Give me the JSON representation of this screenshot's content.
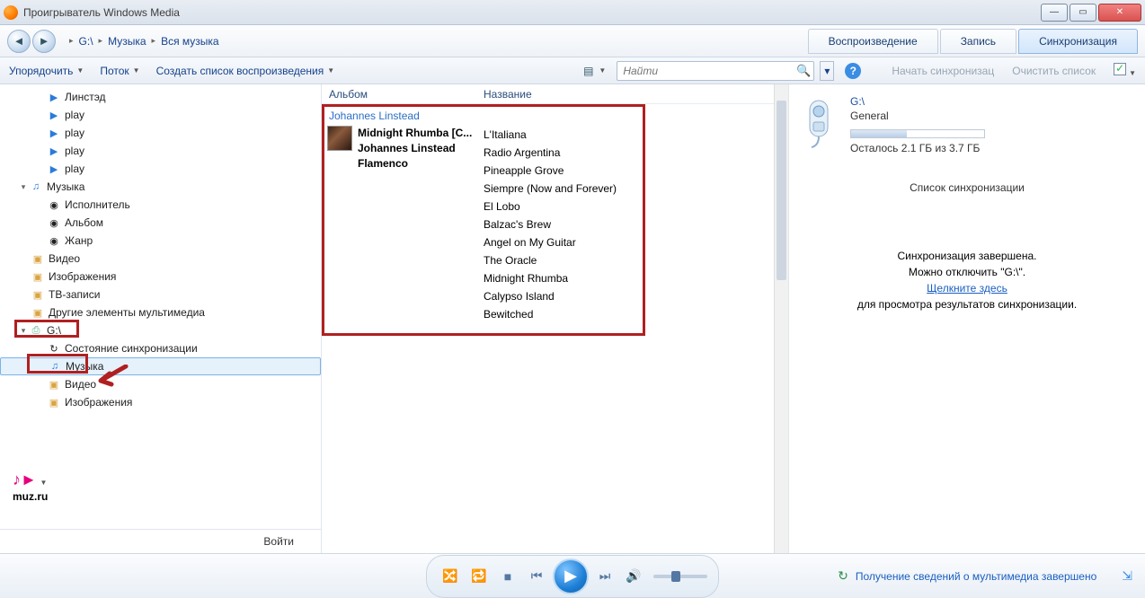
{
  "titlebar": {
    "title": "Проигрыватель Windows Media"
  },
  "breadcrumb": {
    "root": "G:\\",
    "p1": "Музыка",
    "p2": "Вся музыка"
  },
  "tabs": {
    "play": "Воспроизведение",
    "burn": "Запись",
    "sync": "Синхронизация"
  },
  "toolbar": {
    "organize": "Упорядочить",
    "stream": "Поток",
    "create_playlist": "Создать список воспроизведения",
    "search_placeholder": "Найти",
    "start_sync": "Начать синхронизац",
    "clear_list": "Очистить список"
  },
  "sidebar": {
    "items": [
      {
        "label": "Линстэд",
        "icon": "playlist",
        "lvl": 2
      },
      {
        "label": "play",
        "icon": "playlist",
        "lvl": 2
      },
      {
        "label": "play",
        "icon": "playlist",
        "lvl": 2
      },
      {
        "label": "play",
        "icon": "playlist",
        "lvl": 2
      },
      {
        "label": "play",
        "icon": "playlist",
        "lvl": 2
      },
      {
        "label": "Музыка",
        "icon": "note",
        "lvl": 1,
        "exp": "▾"
      },
      {
        "label": "Исполнитель",
        "icon": "disc",
        "lvl": 2
      },
      {
        "label": "Альбом",
        "icon": "disc",
        "lvl": 2
      },
      {
        "label": "Жанр",
        "icon": "disc",
        "lvl": 2
      },
      {
        "label": "Видео",
        "icon": "folder",
        "lvl": 1
      },
      {
        "label": "Изображения",
        "icon": "folder",
        "lvl": 1
      },
      {
        "label": "ТВ-записи",
        "icon": "folder",
        "lvl": 1
      },
      {
        "label": "Другие элементы мультимедиа",
        "icon": "folder",
        "lvl": 1
      },
      {
        "label": "G:\\",
        "icon": "device",
        "lvl": 1,
        "exp": "▾"
      },
      {
        "label": "Состояние синхронизации",
        "icon": "sync",
        "lvl": 2
      },
      {
        "label": "Музыка",
        "icon": "note",
        "lvl": 2,
        "sel": true
      },
      {
        "label": "Видео",
        "icon": "folder",
        "lvl": 2
      },
      {
        "label": "Изображения",
        "icon": "folder",
        "lvl": 2
      }
    ],
    "login": "Войти",
    "logo": "muz.ru"
  },
  "columns": {
    "album": "Альбом",
    "title": "Название"
  },
  "artist_header": "Johannes Linstead",
  "album": {
    "title": "Midnight Rhumba [C...",
    "artist": "Johannes Linstead",
    "genre": "Flamenco"
  },
  "tracks": [
    "L'Italiana",
    "Radio Argentina",
    "Pineapple Grove",
    "Siempre (Now and Forever)",
    "El Lobo",
    "Balzac's Brew",
    "Angel on My Guitar",
    "The Oracle",
    "Midnight Rhumba",
    "Calypso Island",
    "Bewitched"
  ],
  "device": {
    "name": "G:\\",
    "type": "General",
    "space": "Осталось 2.1 ГБ из 3.7 ГБ"
  },
  "sync": {
    "list_title": "Список синхронизации",
    "done": "Синхронизация завершена.",
    "disconnect": "Можно отключить \"G:\\\".",
    "click_here": "Щелкните здесь",
    "for_results": "для просмотра результатов синхронизации."
  },
  "player": {
    "status": "Получение сведений о мультимедиа завершено"
  }
}
